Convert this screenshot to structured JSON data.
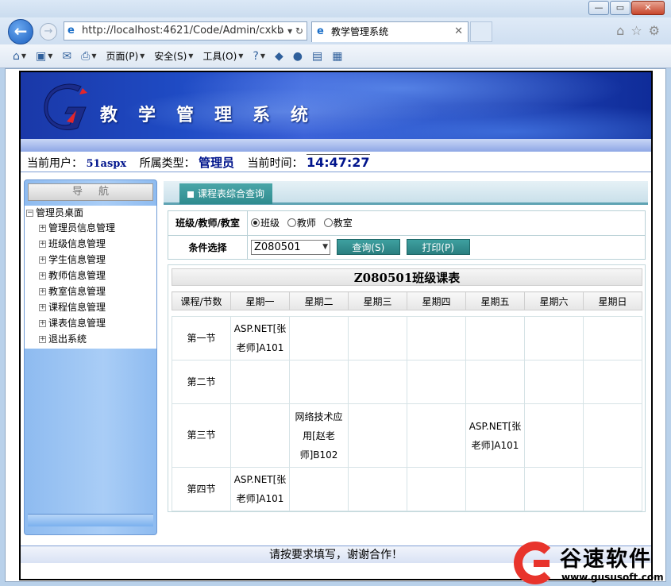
{
  "browser": {
    "address": "http://localhost:4621/Code/Admin/cxkb",
    "tab_title": "教学管理系统",
    "menu": {
      "page": "页面(P)",
      "safety": "安全(S)",
      "tools": "工具(O)"
    }
  },
  "site": {
    "title": "教学管理系统"
  },
  "userline": {
    "user_label": "当前用户：",
    "user_value": "51aspx",
    "type_label": "所属类型：",
    "type_value": "管理员",
    "time_label": "当前时间：",
    "time_value": "14:47:27"
  },
  "nav": {
    "header": "导航",
    "root": "管理员桌面",
    "items": [
      "管理员信息管理",
      "班级信息管理",
      "学生信息管理",
      "教师信息管理",
      "教室信息管理",
      "课程信息管理",
      "课表信息管理",
      "退出系统"
    ]
  },
  "main": {
    "tab_label": "课程表综合查询",
    "query": {
      "row1_label": "班级/教师/教室",
      "radio_class": "班级",
      "radio_teacher": "教师",
      "radio_room": "教室",
      "row2_label": "条件选择",
      "selected": "Z080501",
      "btn_query": "查询(S)",
      "btn_print": "打印(P)"
    },
    "schedule": {
      "title": "Z080501班级课表",
      "headers": [
        "课程/节数",
        "星期一",
        "星期二",
        "星期三",
        "星期四",
        "星期五",
        "星期六",
        "星期日"
      ],
      "rows": [
        {
          "period": "第一节",
          "cells": [
            "ASP.NET[张老师]A101",
            "",
            "",
            "",
            "",
            "",
            ""
          ]
        },
        {
          "period": "第二节",
          "cells": [
            "",
            "",
            "",
            "",
            "",
            "",
            ""
          ]
        },
        {
          "period": "第三节",
          "cells": [
            "",
            "网络技术应用[赵老师]B102",
            "",
            "",
            "ASP.NET[张老师]A101",
            "",
            ""
          ]
        },
        {
          "period": "第四节",
          "cells": [
            "ASP.NET[张老师]A101",
            "",
            "",
            "",
            "",
            "",
            ""
          ]
        }
      ]
    }
  },
  "footer": {
    "text": "请按要求填写，谢谢合作！"
  },
  "watermark": {
    "brand": "谷速软件",
    "url": "www.gususoft.com"
  }
}
